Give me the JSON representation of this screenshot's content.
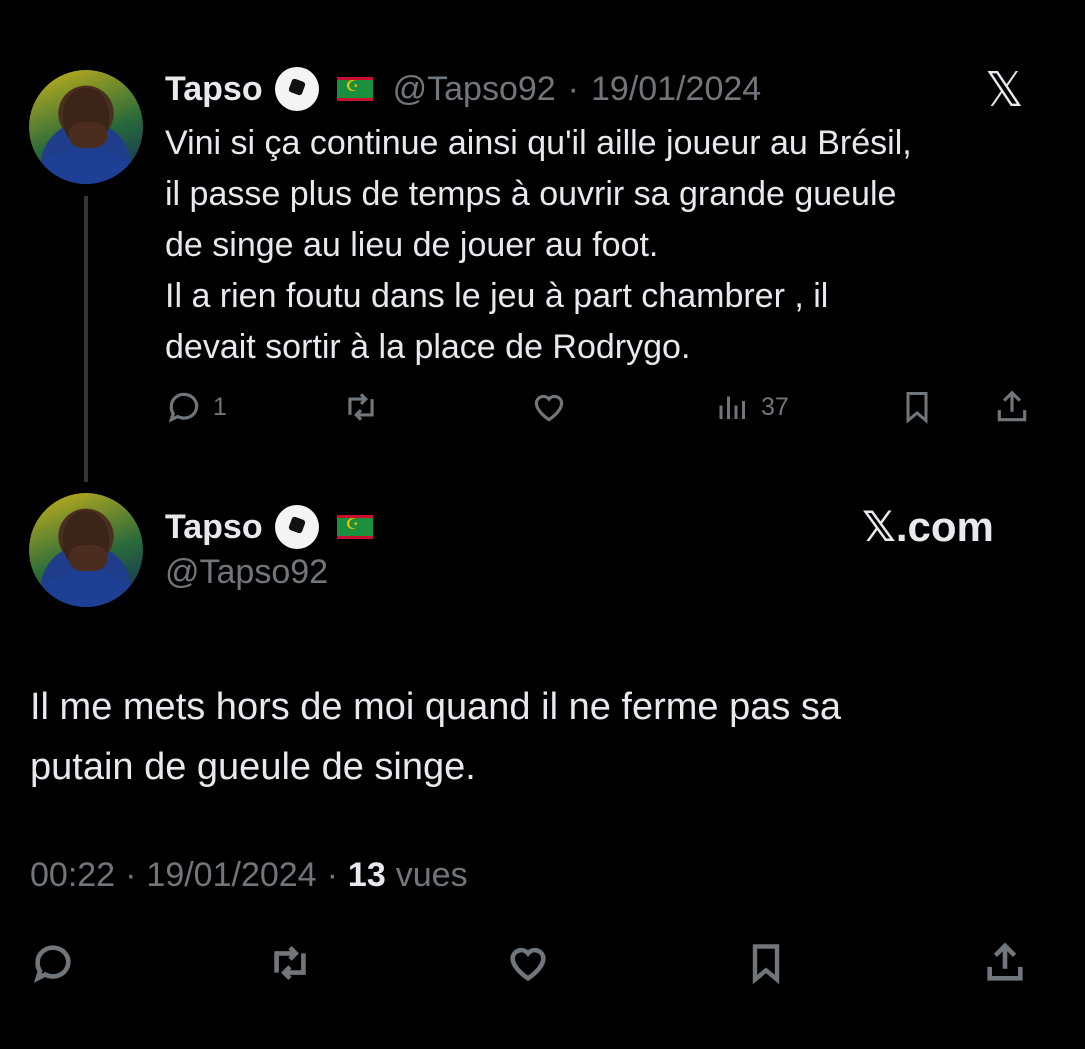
{
  "tweet1": {
    "name": "Tapso",
    "handle": "@Tapso92",
    "sep": "·",
    "date": "19/01/2024",
    "text": "Vini si ça continue ainsi qu'il aille joueur au Brésil,\nil passe plus de temps à  ouvrir sa grande gueule\nde singe au lieu de jouer au foot.\nIl a rien foutu dans le jeu à part chambrer , il\ndevait sortir à la place de Rodrygo.",
    "reply_count": "1",
    "views_count": "37",
    "platform_logo": "𝕏"
  },
  "tweet2": {
    "name": "Tapso",
    "handle": "@Tapso92",
    "brand": "𝕏.com",
    "text": "Il me mets hors de moi quand il ne ferme pas sa\nputain de gueule de singe.",
    "time": "00:22",
    "date": "19/01/2024",
    "sep": "·",
    "views_count": "13",
    "views_label": "vues"
  },
  "icons": [
    "reply-icon",
    "retweet-icon",
    "like-icon",
    "views-icon",
    "bookmark-icon",
    "share-icon",
    "soccer-ball-icon",
    "mauritania-flag-icon"
  ],
  "colors": {
    "background": "#000000",
    "text": "#e7e9ea",
    "secondary": "#71767b"
  }
}
